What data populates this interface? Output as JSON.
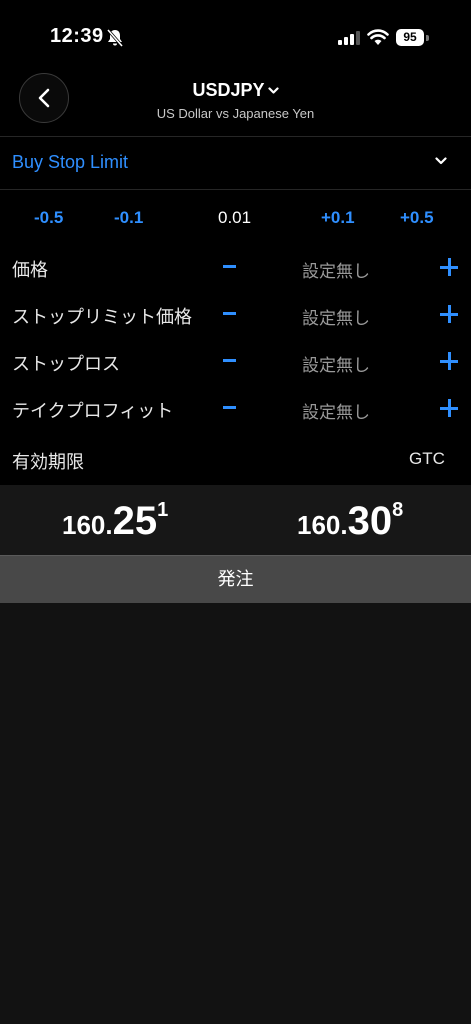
{
  "status_bar": {
    "time": "12:39",
    "battery": "95"
  },
  "header": {
    "symbol": "USDJPY",
    "subtitle": "US Dollar vs Japanese Yen"
  },
  "order_type": "Buy Stop Limit",
  "step": {
    "minus_large": "-0.5",
    "minus_small": "-0.1",
    "value": "0.01",
    "plus_small": "+0.1",
    "plus_large": "+0.5"
  },
  "params": [
    {
      "label": "価格",
      "value": "設定無し"
    },
    {
      "label": "ストップリミット価格",
      "value": "設定無し"
    },
    {
      "label": "ストップロス",
      "value": "設定無し"
    },
    {
      "label": "テイクプロフィット",
      "value": "設定無し"
    }
  ],
  "expiry": {
    "label": "有効期限",
    "value": "GTC"
  },
  "bid": {
    "prefix": "160.",
    "main": "25",
    "pip": "1"
  },
  "ask": {
    "prefix": "160.",
    "main": "30",
    "pip": "8"
  },
  "submit_label": "発注",
  "colors": {
    "accent": "#2f8fff",
    "background": "#000000",
    "panel": "#121212",
    "button": "#484848"
  }
}
